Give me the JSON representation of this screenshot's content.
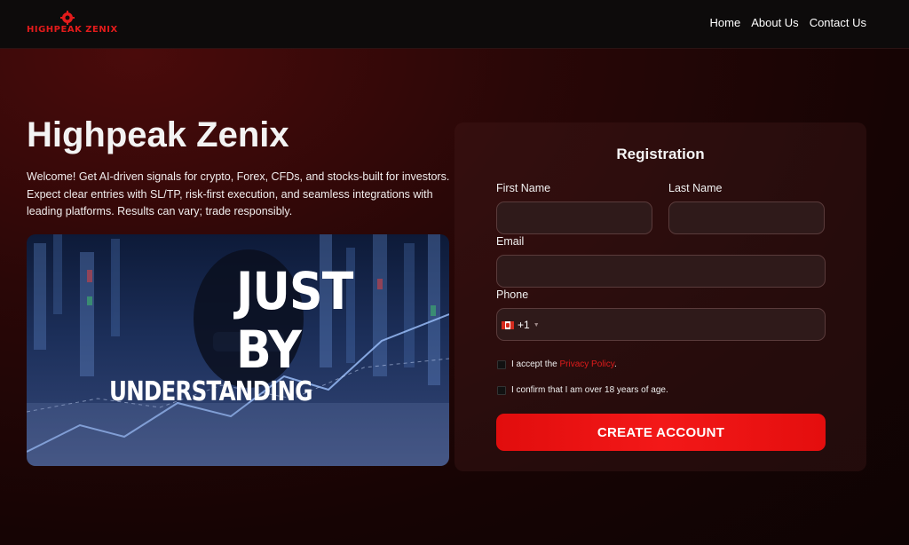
{
  "header": {
    "logo_text": "HIGHPEAK ZENIX",
    "nav": [
      {
        "label": "Home"
      },
      {
        "label": "About Us"
      },
      {
        "label": "Contact Us"
      }
    ]
  },
  "hero": {
    "title": "Highpeak Zenix",
    "description": "Welcome! Get AI-driven signals for crypto, Forex, CFDs, and stocks-built for investors. Expect clear entries with SL/TP, risk-first execution, and seamless integrations with leading platforms. Results can vary; trade responsibly.",
    "image_text": {
      "line1": "JUST",
      "line2": "BY",
      "line3": "UNDERSTANDING"
    }
  },
  "form": {
    "title": "Registration",
    "first_name_label": "First Name",
    "first_name_value": "",
    "last_name_label": "Last Name",
    "last_name_value": "",
    "email_label": "Email",
    "email_value": "",
    "phone_label": "Phone",
    "phone_value": "",
    "phone_country_code": "+1",
    "privacy_text_before": "I accept the ",
    "privacy_link": "Privacy Policy",
    "privacy_text_after": ".",
    "age_text": "I confirm that I am over 18 years of age.",
    "submit_label": "CREATE ACCOUNT"
  },
  "colors": {
    "accent": "#e31b1b",
    "background": "#1a0505",
    "header": "#0d0b0b"
  },
  "icons": {
    "logo": "gear-emblem-icon",
    "phone_flag": "canada-flag-icon",
    "phone_caret": "caret-down-icon"
  }
}
